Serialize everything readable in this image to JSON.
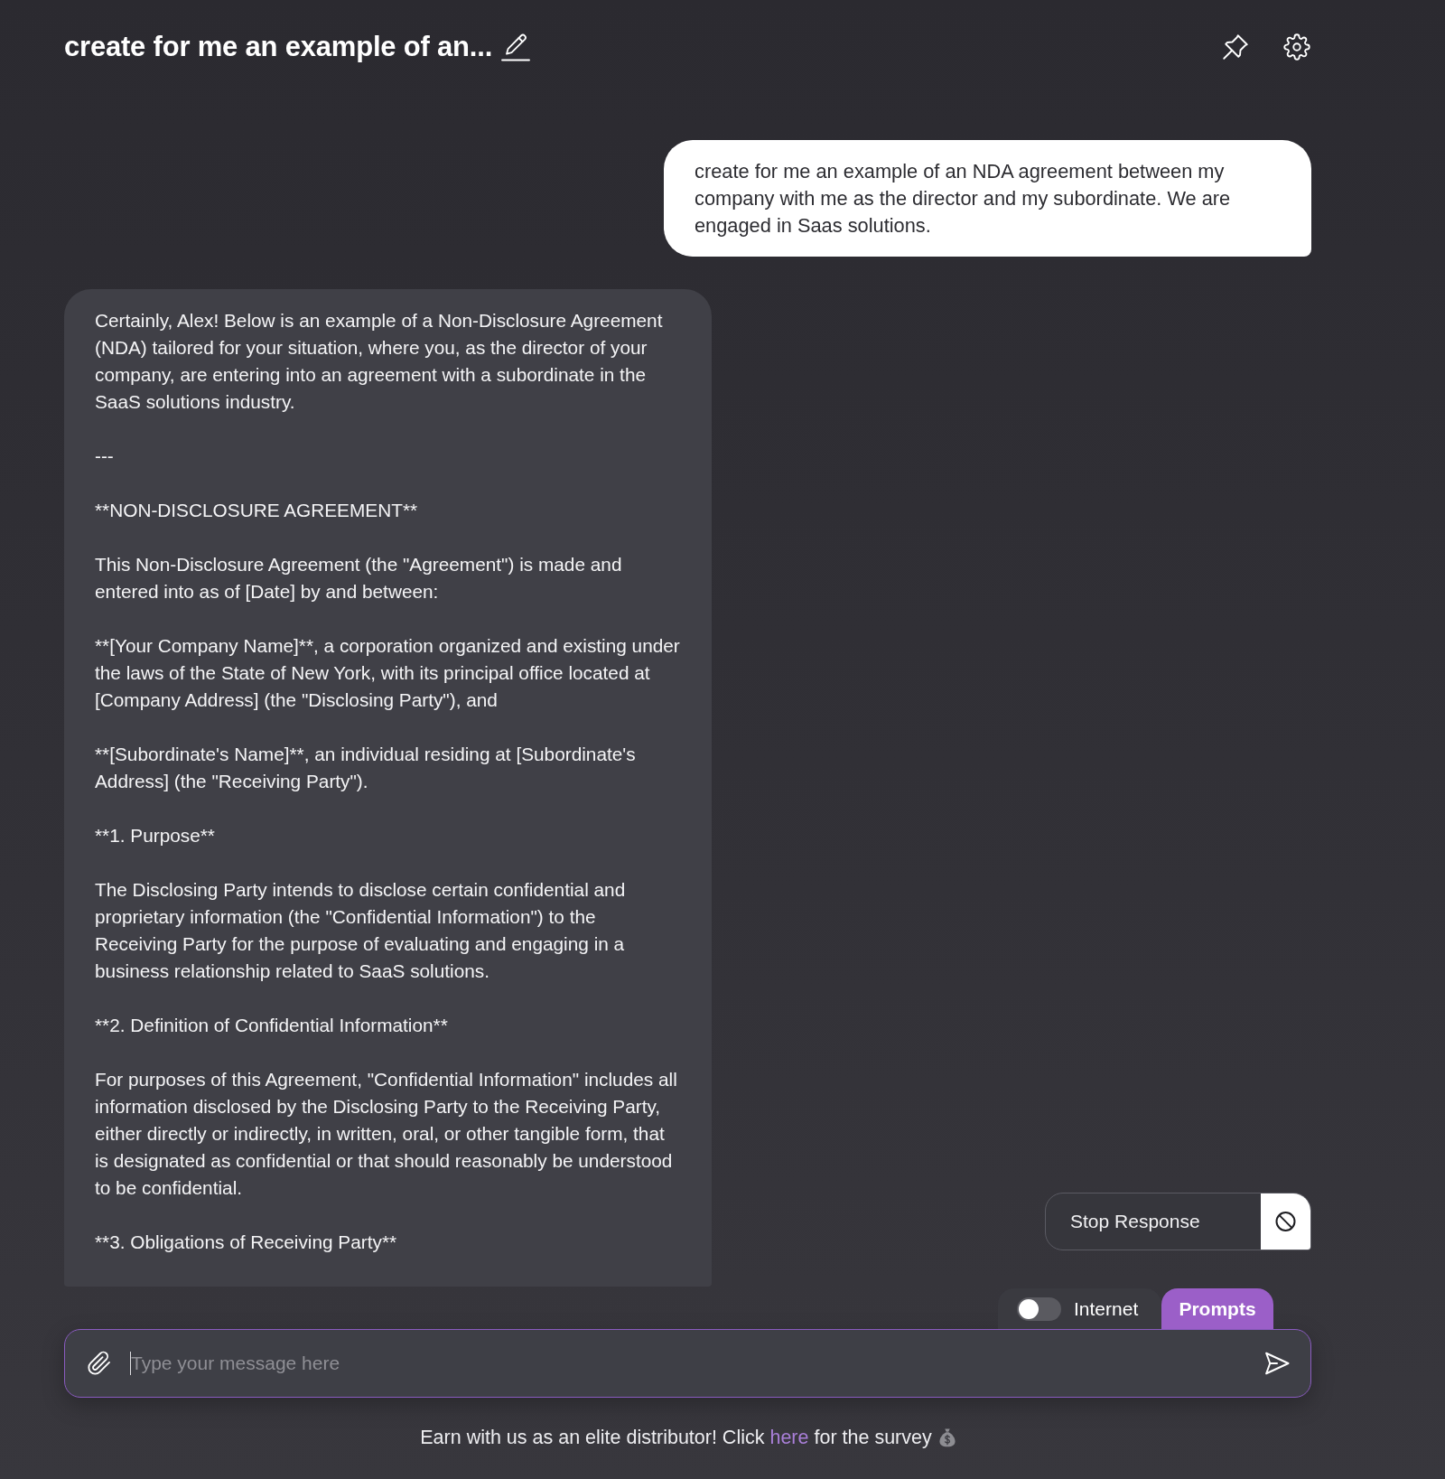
{
  "header": {
    "title": "create for me an example of an..."
  },
  "messages": [
    {
      "kind": "user",
      "paragraphs": [
        "create for me an example of an NDA agreement between my company with me as the director and my subordinate. We are engaged in Saas solutions."
      ]
    },
    {
      "kind": "assistant",
      "paragraphs": [
        "Certainly, Alex! Below is an example of a Non-Disclosure Agreement (NDA) tailored for your situation, where you, as the director of your company, are entering into an agreement with a subordinate in the SaaS solutions industry.",
        "---",
        "**NON-DISCLOSURE AGREEMENT**",
        "This Non-Disclosure Agreement (the \"Agreement\") is made and entered into as of [Date] by and between:",
        "**[Your Company Name]**, a corporation organized and existing under the laws of the State of New York, with its principal office located at [Company Address] (the \"Disclosing Party\"), and",
        "**[Subordinate's Name]**, an individual residing at [Subordinate's Address] (the \"Receiving Party\").",
        "**1. Purpose**",
        "The Disclosing Party intends to disclose certain confidential and proprietary information (the \"Confidential Information\") to the Receiving Party for the purpose of evaluating and engaging in a business relationship related to SaaS solutions.",
        "**2. Definition of Confidential Information**",
        "For purposes of this Agreement, \"Confidential Information\" includes all information disclosed by the Disclosing Party to the Receiving Party, either directly or indirectly, in written, oral, or other tangible form, that is designated as confidential or that should reasonably be understood to be confidential.",
        "**3. Obligations of Receiving Party**"
      ]
    }
  ],
  "stop_button": {
    "label": "Stop Response"
  },
  "composer": {
    "tabs": [
      {
        "kind": "toggle",
        "label": "Internet",
        "on": false
      },
      {
        "kind": "button",
        "label": "Prompts"
      }
    ],
    "input": {
      "placeholder": "Type your message here",
      "focused": true
    }
  },
  "footer": {
    "text_before": "Earn with us as an elite distributor! Click",
    "link": "here",
    "text_after": "for the survey"
  }
}
